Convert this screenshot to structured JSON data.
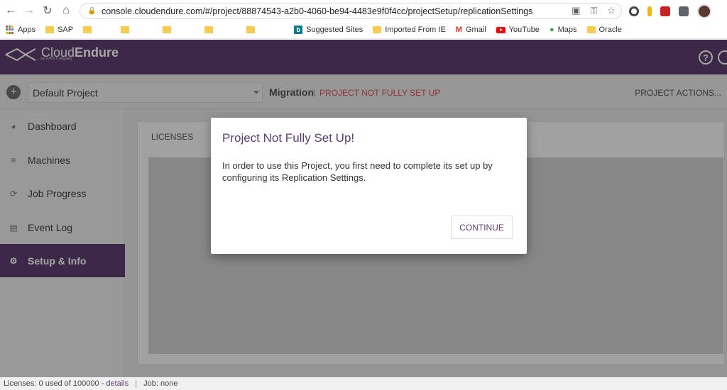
{
  "browser": {
    "url": "console.cloudendure.com/#/project/88874543-a2b0-4060-be94-4483e9f0f4cc/projectSetup/replicationSettings",
    "bookmarks": [
      {
        "label": "Apps",
        "icon": "apps-grid-icon"
      },
      {
        "label": "SAP",
        "icon": "folder-icon"
      },
      {
        "label": "",
        "icon": "folder-icon"
      },
      {
        "label": "",
        "icon": "folder-icon"
      },
      {
        "label": "",
        "icon": "folder-icon"
      },
      {
        "label": "",
        "icon": "folder-icon"
      },
      {
        "label": "",
        "icon": "folder-icon"
      },
      {
        "label": "Suggested Sites",
        "icon": "bing-icon"
      },
      {
        "label": "Imported From IE",
        "icon": "folder-icon"
      },
      {
        "label": "Gmail",
        "icon": "gmail-icon"
      },
      {
        "label": "YouTube",
        "icon": "youtube-icon"
      },
      {
        "label": "Maps",
        "icon": "maps-icon"
      },
      {
        "label": "Oracle",
        "icon": "folder-icon"
      }
    ]
  },
  "header": {
    "brand_light": "Cloud",
    "brand_bold": "Endure",
    "brand_sub": "An AWS Company",
    "help_label": "?"
  },
  "project_bar": {
    "add_label": "+",
    "project_name": "Default Project",
    "mode": "Migration",
    "separator": "|",
    "status": "PROJECT NOT FULLY SET UP",
    "actions_label": "PROJECT ACTIONS..."
  },
  "sidebar": {
    "items": [
      {
        "label": "Dashboard",
        "icon": "dashboard-icon"
      },
      {
        "label": "Machines",
        "icon": "machines-icon"
      },
      {
        "label": "Job Progress",
        "icon": "job-progress-icon"
      },
      {
        "label": "Event Log",
        "icon": "event-log-icon"
      },
      {
        "label": "Setup & Info",
        "icon": "gear-icon",
        "active": true
      }
    ]
  },
  "main": {
    "tab_label": "LICENSES"
  },
  "modal": {
    "title": "Project Not Fully Set Up!",
    "body": "In order to use this Project, you first need to complete its set up by configuring its Replication Settings.",
    "button_label": "CONTINUE"
  },
  "statusbar": {
    "licenses_label": "Licenses:",
    "licenses_value": "0 used of 100000 - ",
    "details_link": "details",
    "separator": "|",
    "job_label": "Job:",
    "job_value": "none"
  },
  "colors": {
    "brand_purple": "#5b3f6e",
    "status_red": "#d9534f"
  }
}
